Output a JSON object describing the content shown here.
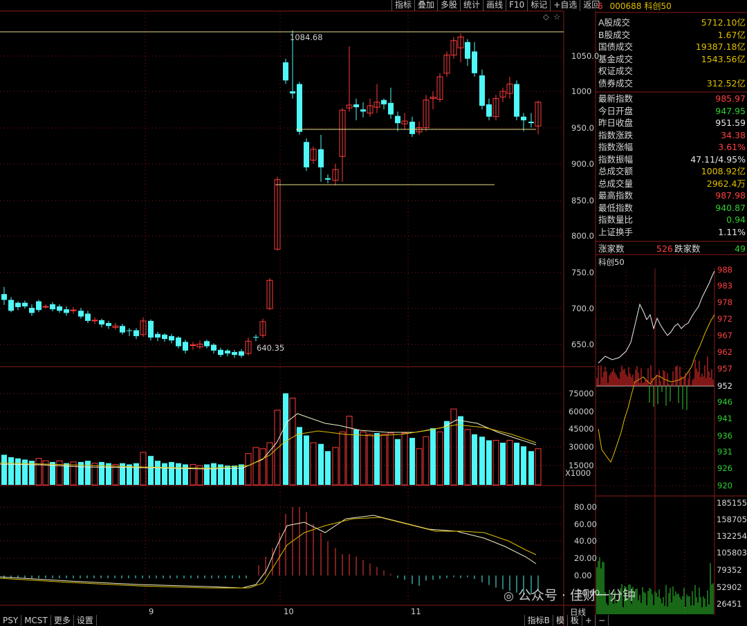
{
  "toolbar": [
    "指标",
    "叠加",
    "多股",
    "统计",
    "画线",
    "F10",
    "标记",
    "+自选",
    "返回"
  ],
  "header": {
    "num": "6",
    "code": "000688",
    "name": "科创50"
  },
  "market": [
    {
      "label": "A股成交",
      "value": "5712.10亿",
      "color": "#e0c000"
    },
    {
      "label": "B股成交",
      "value": "1.67亿",
      "color": "#e0c000"
    },
    {
      "label": "国债成交",
      "value": "19387.18亿",
      "color": "#e0c000"
    },
    {
      "label": "基金成交",
      "value": "1543.56亿",
      "color": "#e0c000"
    },
    {
      "label": "权证成交",
      "value": "",
      "color": "#e0c000"
    },
    {
      "label": "债券成交",
      "value": "312.52亿",
      "color": "#e0c000"
    }
  ],
  "index": [
    {
      "label": "最新指数",
      "value": "985.97",
      "color": "#ff4040"
    },
    {
      "label": "今日开盘",
      "value": "947.95",
      "color": "#30d030"
    },
    {
      "label": "昨日收盘",
      "value": "951.59",
      "color": "#e8e8e8"
    },
    {
      "label": "指数涨跌",
      "value": "34.38",
      "color": "#ff4040"
    },
    {
      "label": "指数涨幅",
      "value": "3.61%",
      "color": "#ff4040"
    },
    {
      "label": "指数振幅",
      "value": "47.11/4.95%",
      "color": "#e8e8e8"
    },
    {
      "label": "总成交额",
      "value": "1008.92亿",
      "color": "#e0c000"
    },
    {
      "label": "总成交量",
      "value": "2962.4万",
      "color": "#e0c000"
    },
    {
      "label": "最高指数",
      "value": "987.98",
      "color": "#ff4040"
    },
    {
      "label": "最低指数",
      "value": "940.87",
      "color": "#30d030"
    },
    {
      "label": "指数量比",
      "value": "0.94",
      "color": "#30d030"
    },
    {
      "label": "上证换手",
      "value": "1.11%",
      "color": "#e8e8e8"
    }
  ],
  "breadth": {
    "up_label": "涨家数",
    "up": "526",
    "down_label": "跌家数",
    "down": "49"
  },
  "mini_title": "科创50",
  "mini_axis": [
    "988",
    "983",
    "978",
    "972",
    "967",
    "962",
    "957",
    "952",
    "946",
    "941",
    "936",
    "931",
    "926",
    "920"
  ],
  "mini_vol_axis": [
    "185155",
    "158705",
    "132254",
    "105803",
    "79352",
    "52902",
    "26451"
  ],
  "price_axis": [
    "1050.0",
    "1000",
    "950.0",
    "900.0",
    "850.0",
    "800.0",
    "750.0",
    "700.0",
    "650.0"
  ],
  "annotations": {
    "high": "1084.68",
    "low": "640.35",
    "diamond": "◇",
    "star": "☆"
  },
  "vol_axis": [
    "75000",
    "60000",
    "45000",
    "30000",
    "15000"
  ],
  "vol_unit": "X1000",
  "osc_axis": [
    "80.00",
    "60.00",
    "40.00",
    "20.00",
    "0.00",
    "-20.00"
  ],
  "months": [
    "9",
    "10",
    "11"
  ],
  "period": "日线",
  "bottom_tabs": [
    "PSY",
    "MCST",
    "更多",
    "设置"
  ],
  "bottom_right": [
    "指标B",
    "模",
    "板"
  ],
  "watermark": "公众号 · 佳财一分钟"
}
